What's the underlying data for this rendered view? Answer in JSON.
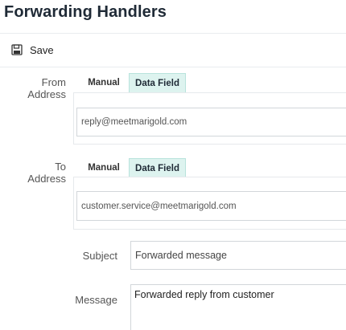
{
  "page": {
    "title": "Forwarding Handlers"
  },
  "toolbar": {
    "save_label": "Save",
    "save_icon": "floppy-disk-icon"
  },
  "from_address": {
    "label_line1": "From",
    "label_line2": "Address",
    "tabs": [
      {
        "label": "Manual"
      },
      {
        "label": "Data Field"
      }
    ],
    "active_tab": "Data Field",
    "value": "reply@meetmarigold.com"
  },
  "to_address": {
    "label_line1": "To",
    "label_line2": "Address",
    "tabs": [
      {
        "label": "Manual"
      },
      {
        "label": "Data Field"
      }
    ],
    "active_tab": "Data Field",
    "value": "customer.service@meetmarigold.com"
  },
  "subject": {
    "label": "Subject",
    "value": "Forwarded message"
  },
  "message": {
    "label": "Message",
    "value": "Forwarded reply from customer"
  },
  "colors": {
    "accent_tab_bg": "#ddf3ef",
    "title": "#1f2a36"
  }
}
